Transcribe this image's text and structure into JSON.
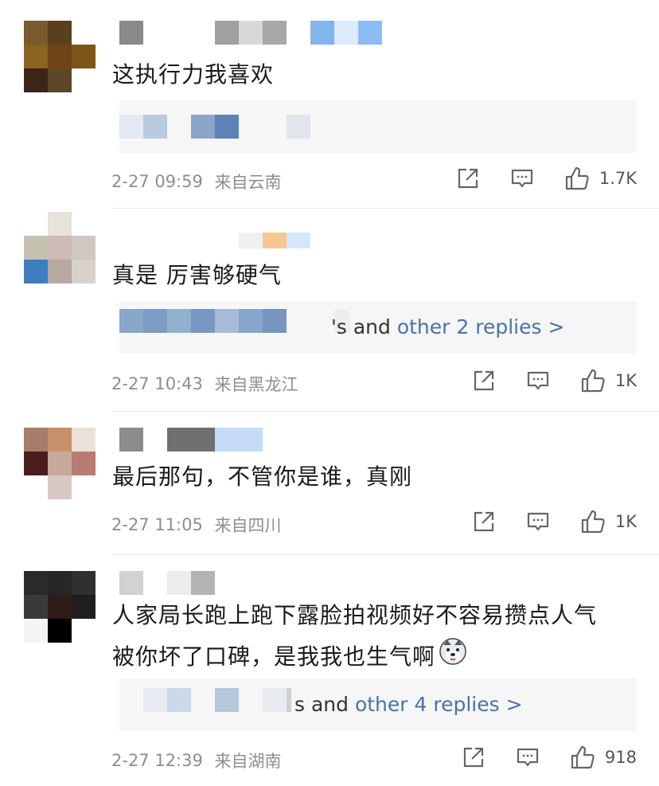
{
  "colors": {
    "link": "#4a72a8",
    "meta": "#8e8e8e",
    "reply_bg": "#f6f6f6"
  },
  "comments": [
    {
      "text_lines": [
        "这执行力我喜欢"
      ],
      "time": "2-27 09:59",
      "location": "来自云南",
      "likes": "1.7K",
      "reply": null
    },
    {
      "text_lines": [
        "真是 厉害够硬气"
      ],
      "time": "2-27 10:43",
      "location": "来自黑龙江",
      "likes": "1K",
      "reply": {
        "prefix": "'s and ",
        "link": "other 2 replies >"
      }
    },
    {
      "text_lines": [
        "最后那句，不管你是谁，真刚"
      ],
      "time": "2-27 11:05",
      "location": "来自四川",
      "likes": "1K",
      "reply": null
    },
    {
      "text_lines": [
        "人家局长跑上跑下露脸拍视频好不容易攒点人气",
        "被你坏了口碑，是我我也生气啊"
      ],
      "time": "2-27 12:39",
      "location": "来自湖南",
      "likes": "918",
      "reply": {
        "prefix": "s and ",
        "link": "other 4 replies >"
      }
    }
  ],
  "icons": {
    "share": "share-icon",
    "comment": "comment-icon",
    "like": "thumbs-up-icon",
    "emoji": "husky-emoji-icon"
  }
}
